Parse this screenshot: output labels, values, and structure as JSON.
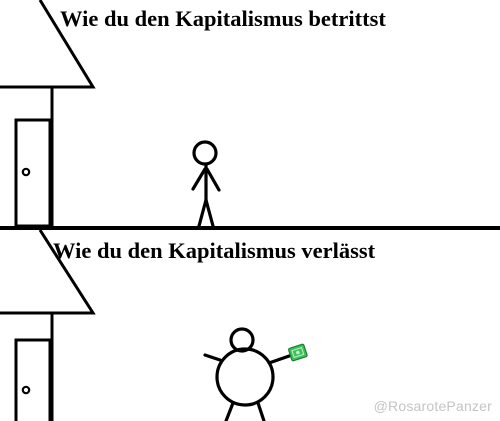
{
  "panels": [
    {
      "caption": "Wie du den Kapitalismus betrittst",
      "figure": "thin-stick-figure"
    },
    {
      "caption": "Wie du den Kapitalismus verlässt",
      "figure": "round-stick-figure-holding-money"
    }
  ],
  "watermark": "@RosarotePanzer",
  "colors": {
    "ink": "#000000",
    "background": "#ffffff",
    "money": "#3cc25a",
    "watermark": "#c4c4c4"
  }
}
